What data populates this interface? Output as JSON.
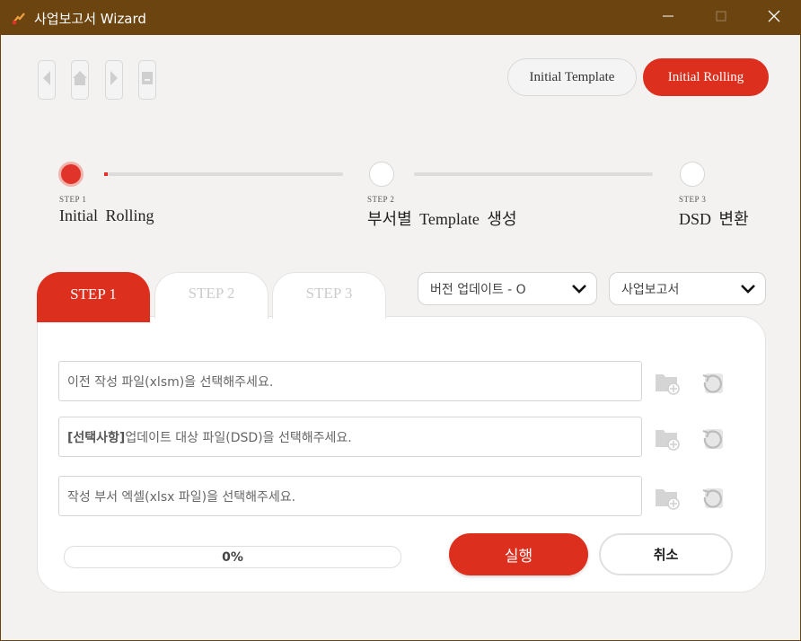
{
  "window": {
    "title": "사업보고서 Wizard",
    "icons": {
      "app": "app-logo-icon",
      "minimize": "minimize-icon",
      "maximize": "maximize-icon",
      "close": "close-icon"
    }
  },
  "nav": {
    "buttons": [
      {
        "icon": "back-arrow-icon"
      },
      {
        "icon": "home-icon"
      },
      {
        "icon": "forward-arrow-icon"
      },
      {
        "icon": "document-icon"
      }
    ]
  },
  "mode_toggle": {
    "template_label": "Initial Template",
    "rolling_label": "Initial Rolling",
    "selected": "Initial Rolling"
  },
  "stepper": {
    "steps": [
      {
        "small": "STEP 1",
        "name": "Initial Rolling",
        "active": true
      },
      {
        "small": "STEP 2",
        "name": "부서별 Template 생성",
        "active": false
      },
      {
        "small": "STEP 3",
        "name": "DSD 변환",
        "active": false
      }
    ]
  },
  "tabs": [
    {
      "label": "STEP 1",
      "active": true
    },
    {
      "label": "STEP 2",
      "active": false
    },
    {
      "label": "STEP 3",
      "active": false
    }
  ],
  "dropdowns": {
    "version": {
      "value": "버전 업데이트 - O",
      "icon": "chevron-down-icon"
    },
    "report": {
      "value": "사업보고서",
      "icon": "chevron-down-icon"
    }
  },
  "files": [
    {
      "prefix": "",
      "placeholder": "이전 작성 파일(xlsm)을 선택해주세요."
    },
    {
      "prefix": "[선택사항]",
      "placeholder": "업데이트 대상 파일(DSD)을 선택해주세요."
    },
    {
      "prefix": "",
      "placeholder": "작성 부서 엑셀(xlsx 파일)을 선택해주세요."
    }
  ],
  "file_icons": {
    "add": "add-folder-icon",
    "reset": "reset-icon"
  },
  "progress": {
    "value": 0,
    "label": "0%"
  },
  "actions": {
    "run": "실행",
    "cancel": "취소"
  },
  "colors": {
    "titlebar": "#6b4410",
    "accent": "#dc2f1e",
    "background": "#f3f2f1"
  }
}
